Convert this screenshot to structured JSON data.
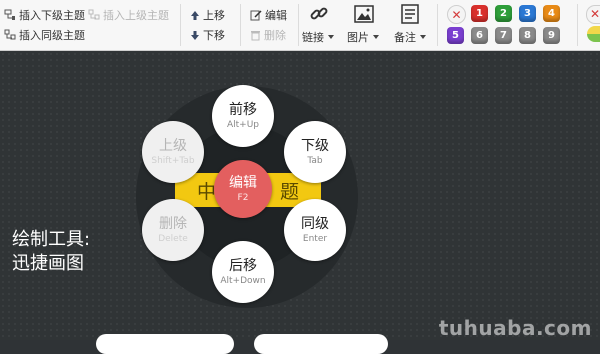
{
  "toolbar": {
    "insert_child": "插入下级主题",
    "insert_parent": "插入上级主题",
    "insert_sibling": "插入同级主题",
    "move_up": "上移",
    "move_down": "下移",
    "edit": "编辑",
    "delete": "删除",
    "link": "链接",
    "image": "图片",
    "note": "备注",
    "priorities": [
      "1",
      "2",
      "3",
      "4",
      "5",
      "6",
      "7",
      "8",
      "9"
    ],
    "priority_colors": [
      "#d9302c",
      "#2e9e3a",
      "#2b78d4",
      "#e88a16",
      "#7a3fd0",
      "#8a8a8a",
      "#8a8a8a",
      "#8a8a8a",
      "#8a8a8a"
    ]
  },
  "canvas": {
    "side_line1": "绘制工具:",
    "side_line2": "迅捷画图",
    "topic_left": "中",
    "topic_right": "题",
    "watermark": "tuhuaba.com"
  },
  "menu": {
    "center": {
      "title": "编辑",
      "key": "F2"
    },
    "top": {
      "title": "前移",
      "key": "Alt+Up"
    },
    "top_right": {
      "title": "下级",
      "key": "Tab"
    },
    "bottom_right": {
      "title": "同级",
      "key": "Enter"
    },
    "bottom": {
      "title": "后移",
      "key": "Alt+Down"
    },
    "bottom_left": {
      "title": "删除",
      "key": "Delete"
    },
    "top_left": {
      "title": "上级",
      "key": "Shift+Tab"
    }
  }
}
